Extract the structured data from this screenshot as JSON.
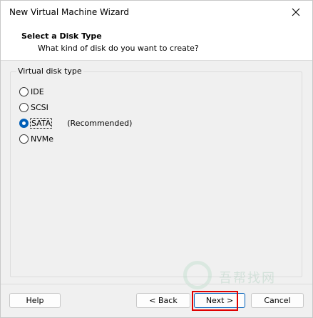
{
  "window": {
    "title": "New Virtual Machine Wizard"
  },
  "header": {
    "title": "Select a Disk Type",
    "subtitle": "What kind of disk do you want to create?"
  },
  "disk_type_group": {
    "label": "Virtual disk type",
    "options": [
      {
        "label": "IDE",
        "selected": false
      },
      {
        "label": "SCSI",
        "selected": false
      },
      {
        "label": "SATA",
        "selected": true,
        "note": "(Recommended)"
      },
      {
        "label": "NVMe",
        "selected": false
      }
    ]
  },
  "buttons": {
    "help": "Help",
    "back": "< Back",
    "next": "Next >",
    "cancel": "Cancel"
  },
  "watermark": {
    "text": "吾帮找网"
  },
  "colors": {
    "accent": "#005fb8",
    "highlight": "#e00000"
  }
}
